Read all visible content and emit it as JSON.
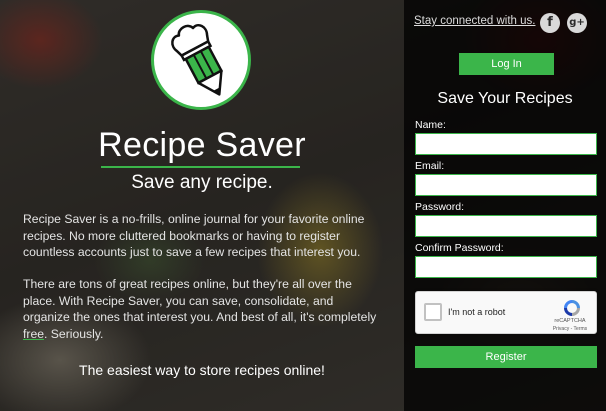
{
  "hero": {
    "app_title": "Recipe Saver",
    "subtitle": "Save any recipe.",
    "description_1": "Recipe Saver is a no-frills, online journal for your favorite online recipes. No more cluttered bookmarks or having to register countless accounts just to save a few recipes that interest you.",
    "description_2_before": "There are tons of great recipes online, but they're all over the place. With Recipe Saver, you can save, consolidate, and organize the ones that interest you. And best of all, it's completely ",
    "description_2_link": "free",
    "description_2_after": ". Seriously.",
    "tagline": "The easiest way to store recipes online!",
    "logo_icon": "pencil-chef-hat-icon"
  },
  "header": {
    "stay_connected": "Stay connected with us.",
    "facebook_glyph": "f",
    "google_plus_glyph": "g+",
    "login_label": "Log In"
  },
  "register_form": {
    "title": "Save Your Recipes",
    "name_label": "Name:",
    "email_label": "Email:",
    "password_label": "Password:",
    "confirm_password_label": "Confirm Password:",
    "captcha_text": "I'm not a robot",
    "captcha_brand": "reCAPTCHA",
    "captcha_links": "Privacy - Terms",
    "register_label": "Register"
  },
  "colors": {
    "accent": "#3bb54a",
    "panel_bg": "#000000"
  }
}
